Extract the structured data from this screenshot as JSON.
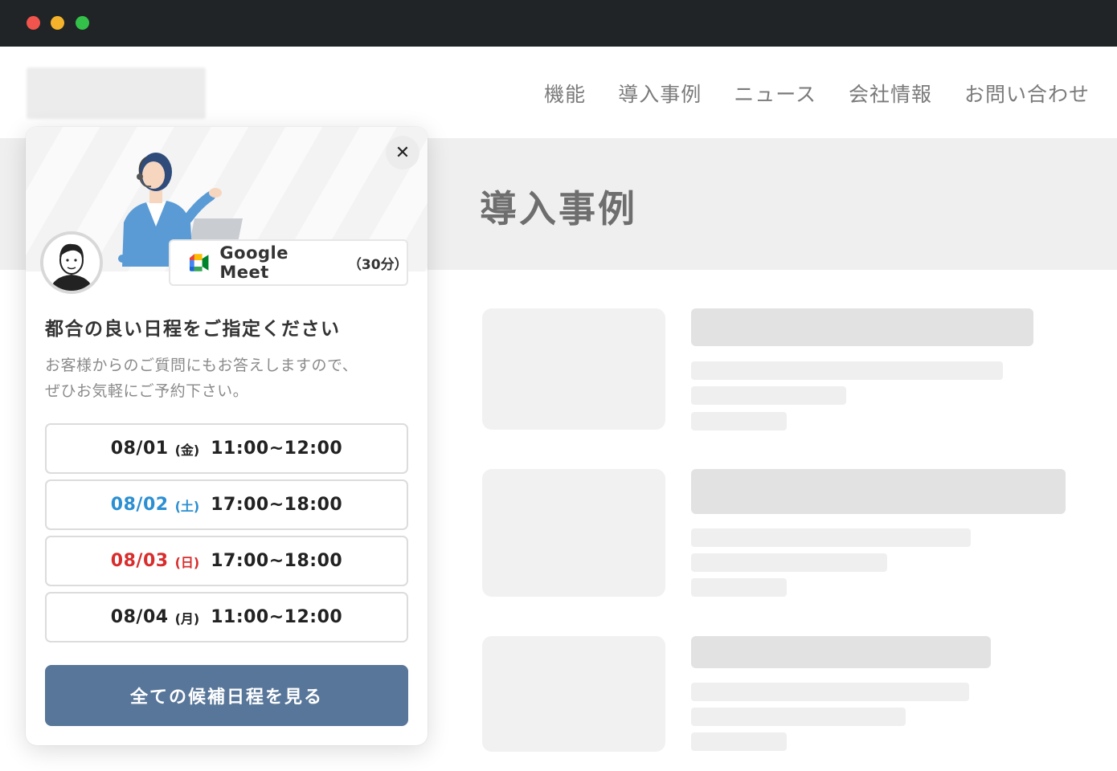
{
  "window": {
    "controls": [
      "close",
      "minimize",
      "maximize"
    ]
  },
  "nav": {
    "items": [
      "機能",
      "導入事例",
      "ニュース",
      "会社情報",
      "お問い合わせ"
    ]
  },
  "hero": {
    "title": "導入事例"
  },
  "popup": {
    "meeting": {
      "name": "Google Meet",
      "duration": "（30分）",
      "icon": "google-meet-icon"
    },
    "heading": "都合の良い日程をご指定ください",
    "description_lines": [
      "お客様からのご質問にもお答えしますので、",
      "ぜひお気軽にご予約下さい。"
    ],
    "slots": [
      {
        "date": "08/01",
        "dow": "(金)",
        "time": "11:00~12:00",
        "color": "#222222"
      },
      {
        "date": "08/02",
        "dow": "(土)",
        "time": "17:00~18:00",
        "color": "#2b8fd1"
      },
      {
        "date": "08/03",
        "dow": "(日)",
        "time": "17:00~18:00",
        "color": "#d82d2d"
      },
      {
        "date": "08/04",
        "dow": "(月)",
        "time": "11:00~12:00",
        "color": "#222222"
      }
    ],
    "all_button": "全ての候補日程を見る",
    "close_icon": "close-icon"
  },
  "colors": {
    "accent_button": "#587699",
    "titlebar": "#202426",
    "saturday": "#2b8fd1",
    "sunday": "#d82d2d"
  }
}
